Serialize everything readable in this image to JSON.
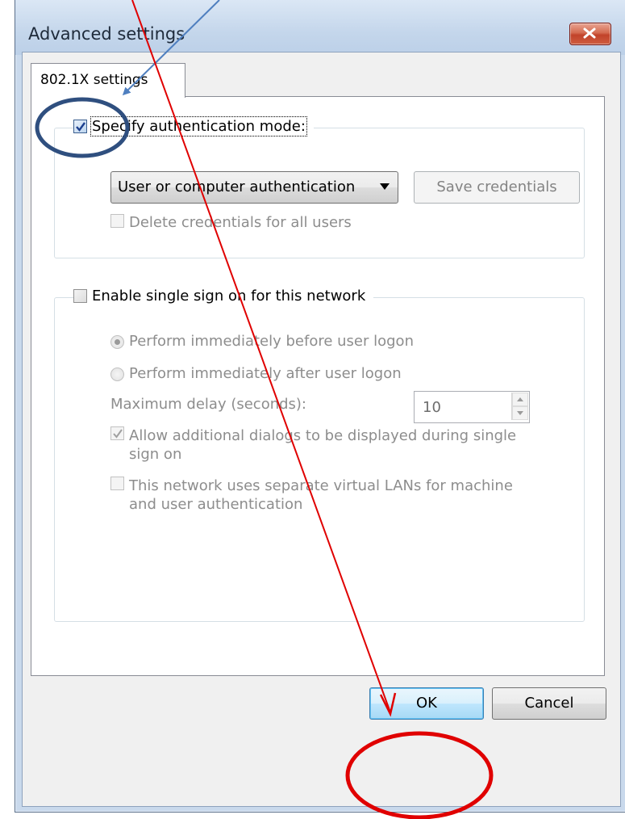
{
  "window": {
    "title": "Advanced settings",
    "close_icon": "close-icon"
  },
  "tabs": [
    {
      "label": "802.1X settings"
    }
  ],
  "auth_group": {
    "checkbox_label": "Specify authentication mode:",
    "checked": true,
    "mode_dropdown": {
      "value": "User or computer authentication"
    },
    "save_credentials_label": "Save credentials",
    "delete_credentials_label": "Delete credentials for all users",
    "delete_credentials_checked": false
  },
  "sso_group": {
    "checkbox_label": "Enable single sign on for this network",
    "checked": false,
    "option_before": "Perform immediately before user logon",
    "option_after": "Perform immediately after user logon",
    "selected_option": "before",
    "max_delay_label": "Maximum delay (seconds):",
    "max_delay_value": "10",
    "allow_dialogs_label_1": "Allow additional dialogs to be displayed during single",
    "allow_dialogs_label_2": "sign on",
    "allow_dialogs_checked": true,
    "separate_vlans_label_1": "This network uses separate virtual LANs for machine",
    "separate_vlans_label_2": "and user authentication",
    "separate_vlans_checked": false
  },
  "buttons": {
    "ok": "OK",
    "cancel": "Cancel"
  },
  "colors": {
    "annotation_red": "#e00000",
    "annotation_blue": "#2f4f7f",
    "arrow_blue": "#4f7fbf"
  }
}
